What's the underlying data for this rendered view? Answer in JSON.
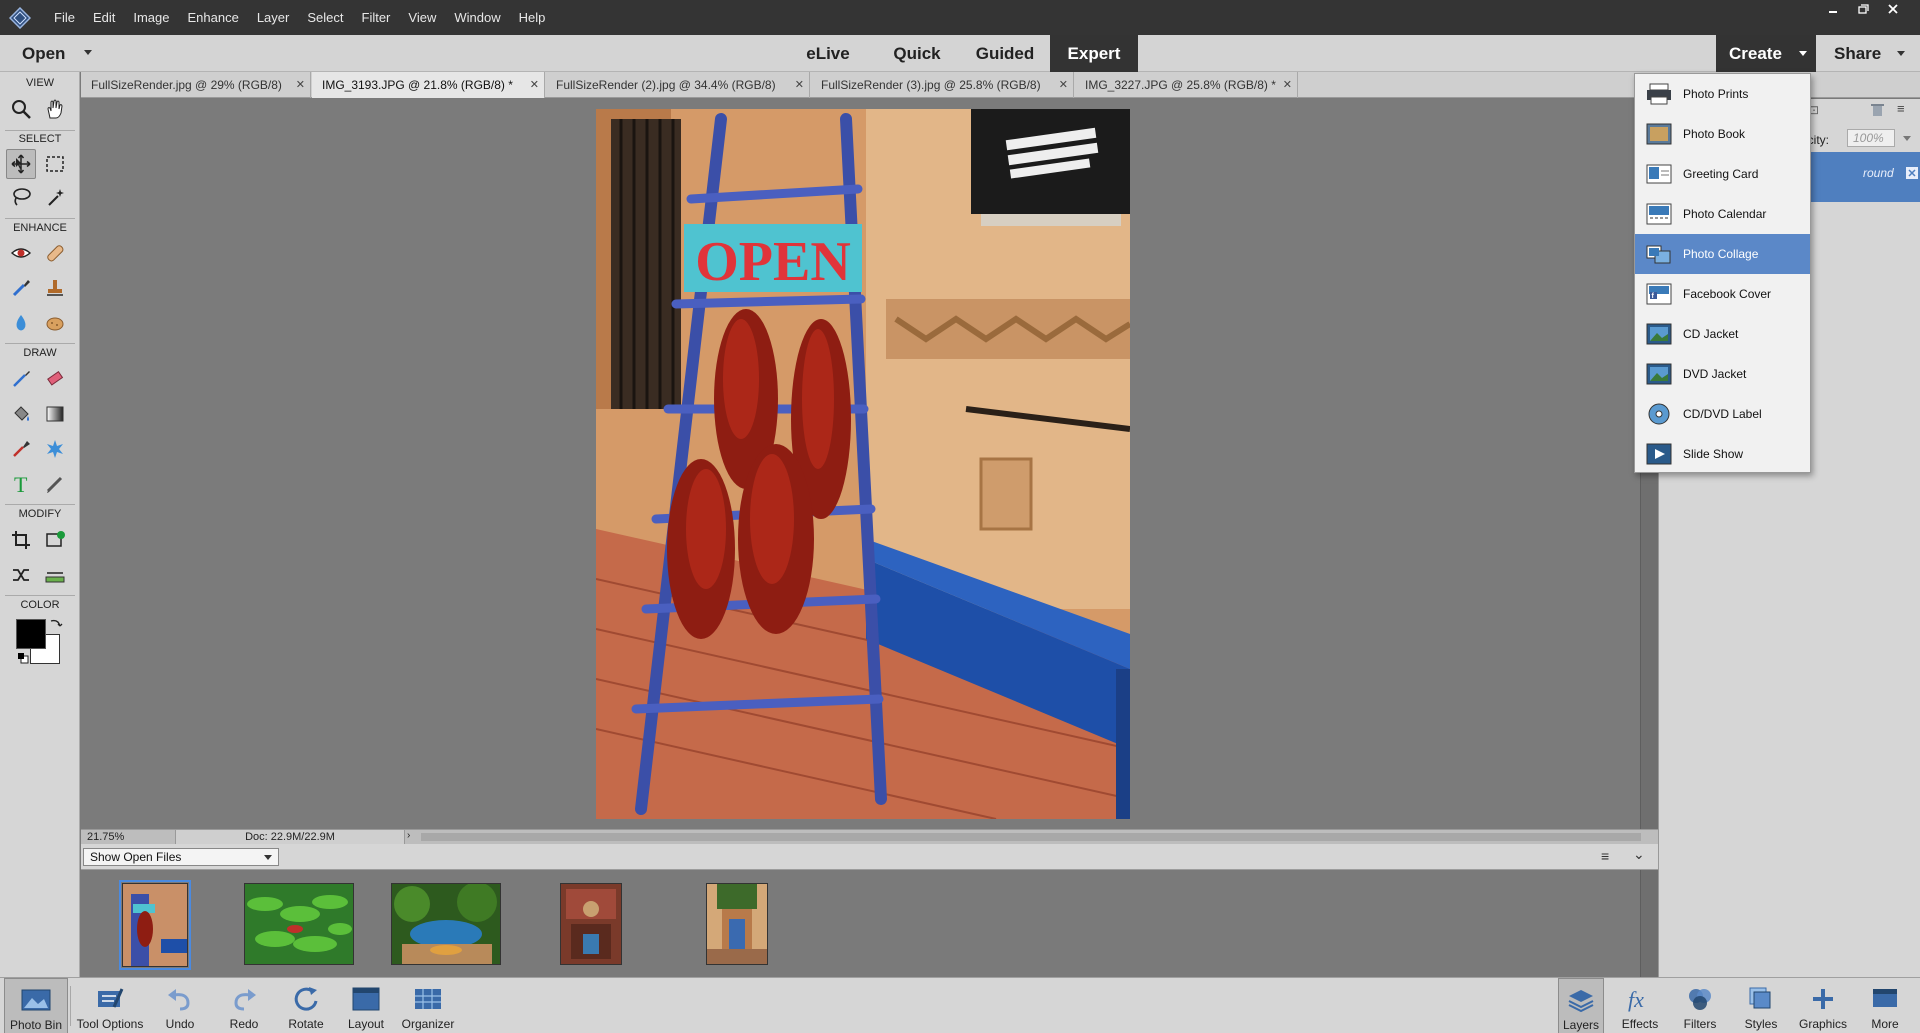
{
  "menubar": {
    "items": [
      "File",
      "Edit",
      "Image",
      "Enhance",
      "Layer",
      "Select",
      "Filter",
      "View",
      "Window",
      "Help"
    ],
    "window_controls": [
      "minimize",
      "restore",
      "close"
    ]
  },
  "modebar": {
    "open_label": "Open",
    "tabs": [
      {
        "label": "eLive",
        "active": false
      },
      {
        "label": "Quick",
        "active": false
      },
      {
        "label": "Guided",
        "active": false
      },
      {
        "label": "Expert",
        "active": true
      }
    ],
    "create_label": "Create",
    "share_label": "Share"
  },
  "toolbox": {
    "sections": {
      "view": "VIEW",
      "select": "SELECT",
      "enhance": "ENHANCE",
      "draw": "DRAW",
      "modify": "MODIFY",
      "color": "COLOR"
    },
    "foreground_color": "#000000",
    "background_color": "#ffffff"
  },
  "document_tabs": [
    {
      "label": "FullSizeRender.jpg @ 29% (RGB/8)",
      "active": false
    },
    {
      "label": "IMG_3193.JPG @ 21.8% (RGB/8) *",
      "active": true
    },
    {
      "label": "FullSizeRender (2).jpg @ 34.4% (RGB/8)",
      "active": false
    },
    {
      "label": "FullSizeRender (3).jpg @ 25.8% (RGB/8)",
      "active": false
    },
    {
      "label": "IMG_3227.JPG @ 25.8% (RGB/8) *",
      "active": false
    }
  ],
  "canvas": {
    "sign_text": "OPEN"
  },
  "statusbar": {
    "zoom": "21.75%",
    "doc_size": "Doc: 22.9M/22.9M"
  },
  "project_bin": {
    "selector_value": "Show Open Files"
  },
  "right_panel": {
    "opacity_label": "acity:",
    "opacity_value": "100%",
    "layer_name": "round"
  },
  "create_menu": {
    "items": [
      {
        "label": "Photo Prints",
        "icon": "printer-icon",
        "highlight": false
      },
      {
        "label": "Photo Book",
        "icon": "photo-book-icon",
        "highlight": false
      },
      {
        "label": "Greeting Card",
        "icon": "greeting-card-icon",
        "highlight": false
      },
      {
        "label": "Photo Calendar",
        "icon": "calendar-icon",
        "highlight": false
      },
      {
        "label": "Photo Collage",
        "icon": "collage-icon",
        "highlight": true
      },
      {
        "label": "Facebook Cover",
        "icon": "facebook-cover-icon",
        "highlight": false
      },
      {
        "label": "CD Jacket",
        "icon": "cd-jacket-icon",
        "highlight": false
      },
      {
        "label": "DVD Jacket",
        "icon": "dvd-jacket-icon",
        "highlight": false
      },
      {
        "label": "CD/DVD Label",
        "icon": "disc-label-icon",
        "highlight": false
      },
      {
        "label": "Slide Show",
        "icon": "slideshow-icon",
        "highlight": false
      }
    ]
  },
  "bottombar": {
    "left": [
      {
        "label": "Photo Bin",
        "icon": "photo-bin-icon",
        "active": true
      },
      {
        "label": "Tool Options",
        "icon": "tool-options-icon",
        "active": false
      },
      {
        "label": "Undo",
        "icon": "undo-icon",
        "active": false
      },
      {
        "label": "Redo",
        "icon": "redo-icon",
        "active": false
      },
      {
        "label": "Rotate",
        "icon": "rotate-icon",
        "active": false
      },
      {
        "label": "Layout",
        "icon": "layout-icon",
        "active": false
      },
      {
        "label": "Organizer",
        "icon": "organizer-icon",
        "active": false
      }
    ],
    "right": [
      {
        "label": "Layers",
        "icon": "layers-icon",
        "active": true
      },
      {
        "label": "Effects",
        "icon": "effects-icon",
        "active": false
      },
      {
        "label": "Filters",
        "icon": "filters-icon",
        "active": false
      },
      {
        "label": "Styles",
        "icon": "styles-icon",
        "active": false
      },
      {
        "label": "Graphics",
        "icon": "graphics-icon",
        "active": false
      },
      {
        "label": "More",
        "icon": "more-icon",
        "active": false
      }
    ]
  },
  "colors": {
    "accent": "#5b88c8",
    "menubar": "#343434",
    "panel": "#d6d6d6",
    "canvas_bg": "#7b7b7b"
  }
}
